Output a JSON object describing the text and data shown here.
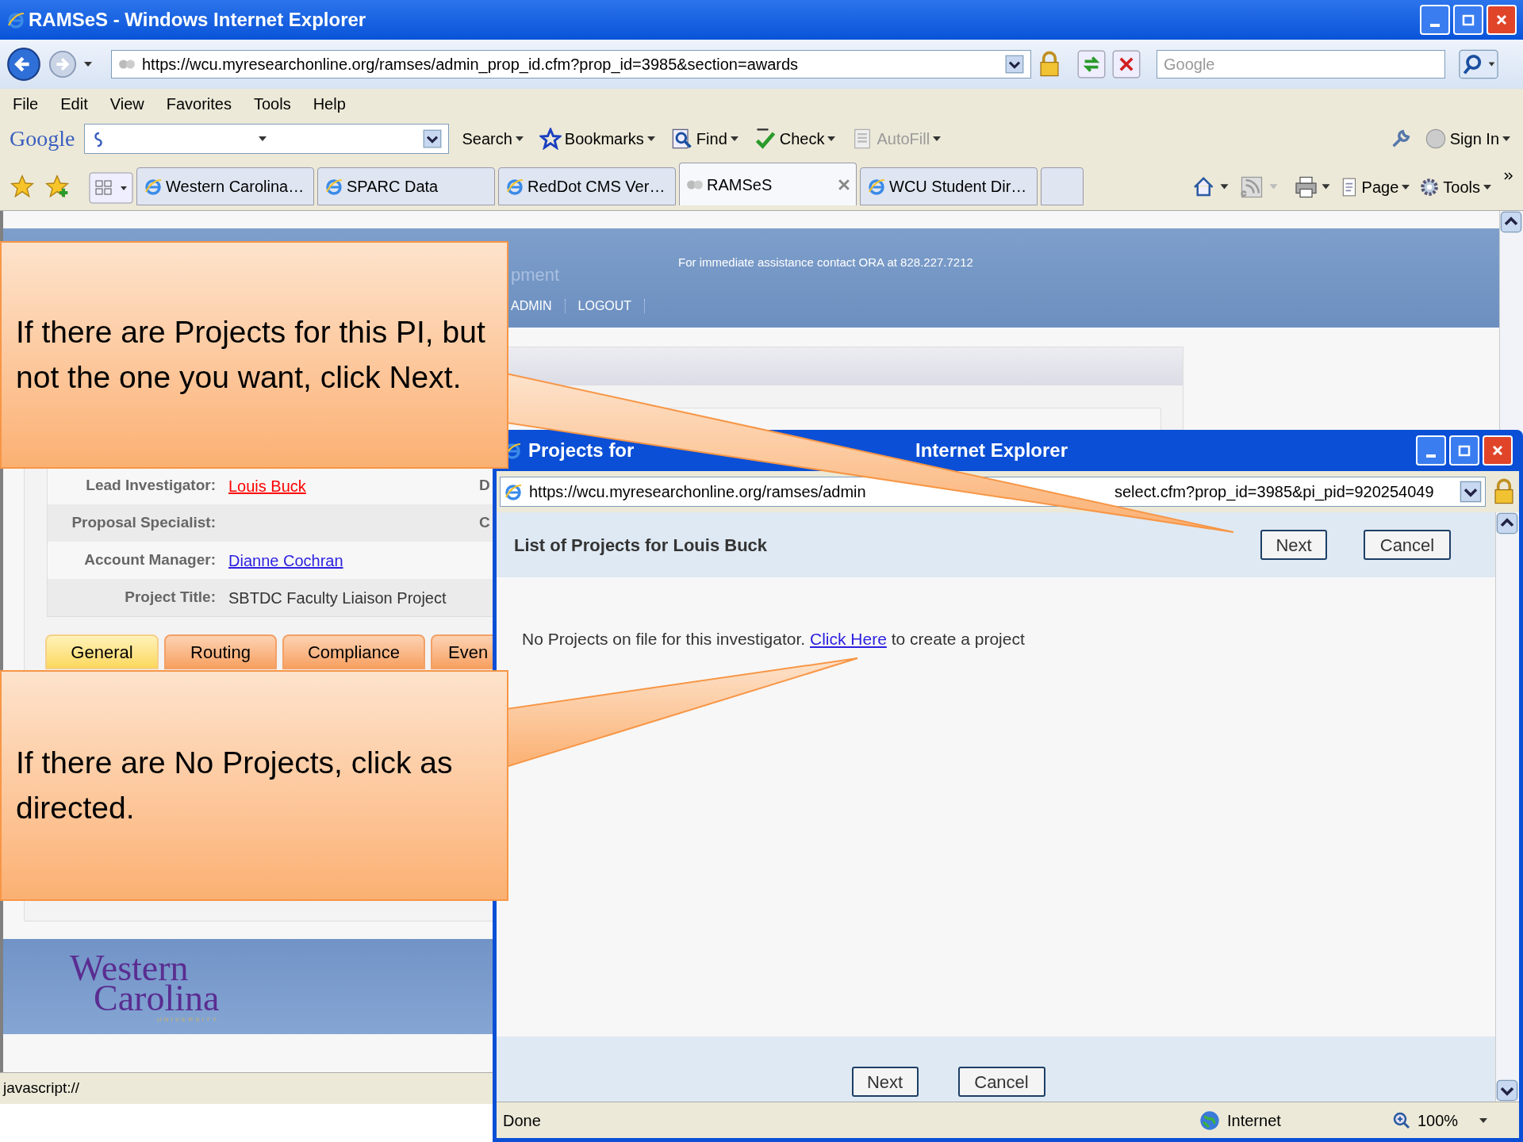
{
  "window": {
    "title": "RAMSeS - Windows Internet Explorer"
  },
  "address_bar": {
    "url": "https://wcu.myresearchonline.org/ramses/admin_prop_id.cfm?prop_id=3985&section=awards"
  },
  "search_box": {
    "placeholder": "Google"
  },
  "menu": [
    "File",
    "Edit",
    "View",
    "Favorites",
    "Tools",
    "Help"
  ],
  "google_toolbar": {
    "logo": "Google",
    "items": [
      {
        "kind": "search",
        "label": "Search",
        "disabled": false
      },
      {
        "kind": "bookmarks",
        "label": "Bookmarks",
        "disabled": false
      },
      {
        "kind": "find",
        "label": "Find",
        "disabled": false
      },
      {
        "kind": "check",
        "label": "Check",
        "disabled": false
      },
      {
        "kind": "autofill",
        "label": "AutoFill",
        "disabled": true
      },
      {
        "kind": "signin",
        "label": "Sign In",
        "disabled": false
      }
    ]
  },
  "tabs": [
    {
      "label": "Western Carolina…",
      "selected": false
    },
    {
      "label": "SPARC Data",
      "selected": false
    },
    {
      "label": "RedDot CMS Ver…",
      "selected": false
    },
    {
      "label": "RAMSeS",
      "selected": true
    },
    {
      "label": "WCU Student Dir…",
      "selected": false
    }
  ],
  "command_bar": [
    "Page",
    "Tools"
  ],
  "page": {
    "header_title": "pment",
    "header_notice": "For immediate assistance contact ORA at 828.227.7212",
    "nav": [
      "ADMIN",
      "LOGOUT"
    ],
    "details": [
      {
        "label": "Lead Investigator:",
        "value": "Louis Buck",
        "kind": "alert-link",
        "column_3": "D"
      },
      {
        "label": "Proposal Specialist:",
        "kind": "empty",
        "column_3": "C"
      },
      {
        "label": "Account Manager:",
        "value": "Dianne Cochran",
        "kind": "link"
      },
      {
        "label": "Project Title:",
        "value": "SBTDC Faculty Liaison Project",
        "kind": "text"
      }
    ],
    "tabs": [
      {
        "label": "General",
        "selected": true
      },
      {
        "label": "Routing",
        "selected": false
      },
      {
        "label": "Compliance",
        "selected": false
      },
      {
        "label": "Even",
        "selected": false
      }
    ],
    "logo": {
      "line1": "Western",
      "line2": "Carolina",
      "line3": "UNIVERSITY"
    }
  },
  "status_bar": {
    "text": "javascript://"
  },
  "popup": {
    "title_parts": [
      "Projects for",
      "Internet Explorer"
    ],
    "url_parts": [
      "https://wcu.myresearchonline.org/ramses/admin",
      "select.cfm?prop_id=3985&pi_pid=920254049"
    ],
    "heading": "List of Projects for Louis Buck",
    "buttons": [
      "Next",
      "Cancel"
    ],
    "message": {
      "before": "No Projects on file for this investigator. ",
      "link": "Click Here",
      "after": " to create a project"
    },
    "footer_buttons": [
      "Next",
      "Cancel"
    ],
    "status": {
      "text": "Done",
      "zone": "Internet",
      "zoom": "100%"
    }
  },
  "callouts": [
    {
      "text": "If there are Projects for this PI, but not the one you want, click Next."
    },
    {
      "text": "If there are No Projects, click as directed."
    }
  ]
}
